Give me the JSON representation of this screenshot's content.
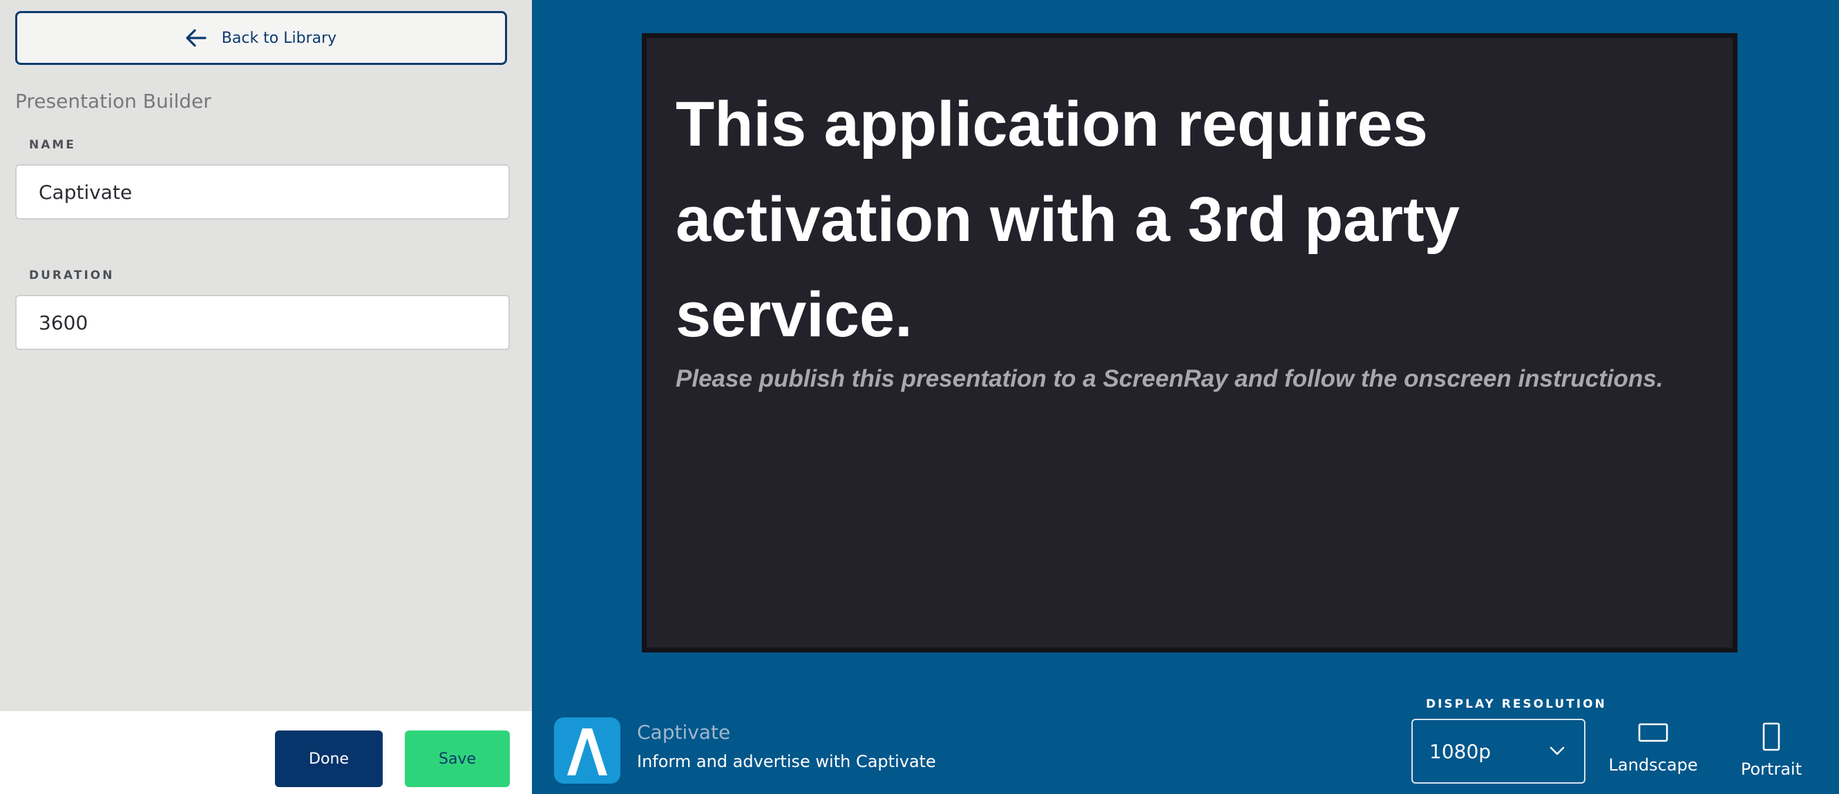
{
  "sidebar": {
    "back_label": "Back to Library",
    "title": "Presentation Builder",
    "name_label": "NAME",
    "name_value": "Captivate",
    "duration_label": "DURATION",
    "duration_value": "3600"
  },
  "footer": {
    "done_label": "Done",
    "save_label": "Save"
  },
  "preview": {
    "heading": "This application requires activation with a 3rd party service.",
    "subheading": "Please publish this presentation to a ScreenRay and follow the onscreen instructions."
  },
  "bottom_bar": {
    "app_name": "Captivate",
    "app_description": "Inform and advertise with Captivate",
    "resolution_label": "DISPLAY RESOLUTION",
    "resolution_value": "1080p",
    "landscape_label": "Landscape",
    "portrait_label": "Portrait"
  },
  "colors": {
    "background": "#02578b",
    "sidebar": "#e2e2e1",
    "primary": "#07346a",
    "save": "#2ed47a",
    "preview": "#23222b",
    "app_icon": "#1897d6"
  },
  "icons": {
    "back": "arrow-left-icon",
    "app": "captivate-logo-icon",
    "dropdown": "chevron-down-icon",
    "landscape": "landscape-rectangle-icon",
    "portrait": "portrait-rectangle-icon"
  }
}
